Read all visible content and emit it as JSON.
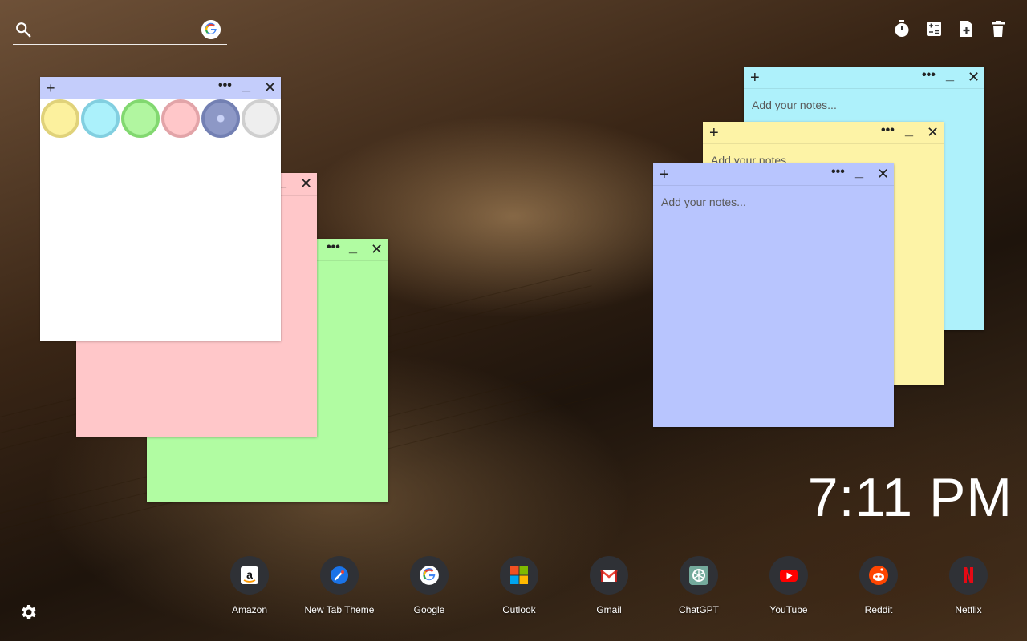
{
  "search": {
    "placeholder": "",
    "engine_icon": "google-icon"
  },
  "toolbar": {
    "timer_icon": "timer-icon",
    "calculator_icon": "calculator-icon",
    "add_note_icon": "add-note-icon",
    "delete_icon": "trash-icon"
  },
  "notes": {
    "white": {
      "color": "#ffffff",
      "plus": "+",
      "dots": "•••",
      "min": "_",
      "close": "✕"
    },
    "pink": {
      "color": "#ffc7c9",
      "close": "✕",
      "min": "_"
    },
    "green": {
      "color": "#b1fca2",
      "plus": "+",
      "dots": "•••",
      "min": "_",
      "close": "✕"
    },
    "cyan": {
      "color": "#aef1fb",
      "plus": "+",
      "dots": "•••",
      "min": "_",
      "close": "✕",
      "placeholder": "Add your notes..."
    },
    "yellow": {
      "color": "#fdf3a6",
      "plus": "+",
      "dots": "•••",
      "min": "_",
      "close": "✕",
      "placeholder": "Add your notes..."
    },
    "blue": {
      "color": "#b8c5fe",
      "plus": "+",
      "dots": "•••",
      "min": "_",
      "close": "✕",
      "placeholder": "Add your notes..."
    }
  },
  "color_picker": [
    {
      "fill": "#fcf19e",
      "ring": "#e0d27a"
    },
    {
      "fill": "#abf1fb",
      "ring": "#82cfe0"
    },
    {
      "fill": "#b1f6a0",
      "ring": "#82d870"
    },
    {
      "fill": "#ffc7c9",
      "ring": "#e2a4a8"
    },
    {
      "fill": "#8d98c6",
      "ring": "#7380b3"
    },
    {
      "fill": "#eeeeee",
      "ring": "#cfcfcf"
    }
  ],
  "clock": {
    "time": "7:11 PM"
  },
  "dock": [
    {
      "label": "Amazon",
      "icon": "amazon-icon"
    },
    {
      "label": "New Tab Theme",
      "icon": "new-tab-theme-icon"
    },
    {
      "label": "Google",
      "icon": "google-icon"
    },
    {
      "label": "Outlook",
      "icon": "outlook-icon"
    },
    {
      "label": "Gmail",
      "icon": "gmail-icon"
    },
    {
      "label": "ChatGPT",
      "icon": "chatgpt-icon"
    },
    {
      "label": "YouTube",
      "icon": "youtube-icon"
    },
    {
      "label": "Reddit",
      "icon": "reddit-icon"
    },
    {
      "label": "Netflix",
      "icon": "netflix-icon"
    }
  ],
  "settings_icon": "gear-icon"
}
